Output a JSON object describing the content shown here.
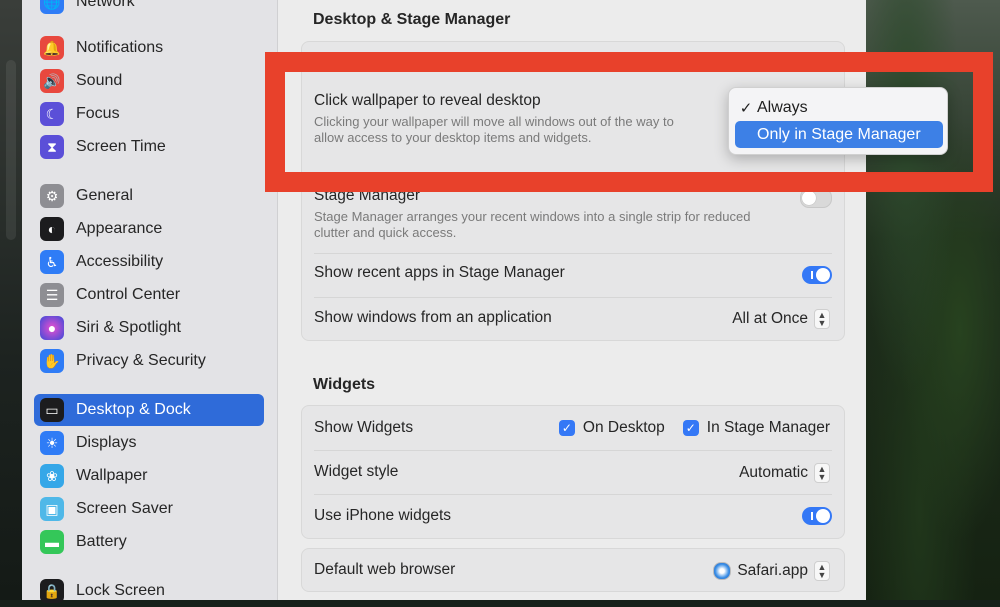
{
  "sidebar": {
    "items": [
      {
        "label": "Network",
        "icon": "globe-icon",
        "color": "#2f7cf6"
      },
      {
        "label": "Notifications",
        "icon": "bell-icon",
        "color": "#e8483e"
      },
      {
        "label": "Sound",
        "icon": "speaker-icon",
        "color": "#e8483e"
      },
      {
        "label": "Focus",
        "icon": "moon-icon",
        "color": "#5b4fd8"
      },
      {
        "label": "Screen Time",
        "icon": "hourglass-icon",
        "color": "#5b4fd8"
      },
      {
        "label": "General",
        "icon": "gear-icon",
        "color": "#8e8e93"
      },
      {
        "label": "Appearance",
        "icon": "appearance-icon",
        "color": "#1c1c1e"
      },
      {
        "label": "Accessibility",
        "icon": "accessibility-icon",
        "color": "#2f7cf6"
      },
      {
        "label": "Control Center",
        "icon": "switches-icon",
        "color": "#8e8e93"
      },
      {
        "label": "Siri & Spotlight",
        "icon": "siri-icon",
        "color": "#7b4fc9"
      },
      {
        "label": "Privacy & Security",
        "icon": "hand-icon",
        "color": "#2f7cf6"
      },
      {
        "label": "Desktop & Dock",
        "icon": "dock-icon",
        "color": "#1c1c1e"
      },
      {
        "label": "Displays",
        "icon": "sun-icon",
        "color": "#2f7cf6"
      },
      {
        "label": "Wallpaper",
        "icon": "flower-icon",
        "color": "#35a7e8"
      },
      {
        "label": "Screen Saver",
        "icon": "screen-saver-icon",
        "color": "#4fb8e8"
      },
      {
        "label": "Battery",
        "icon": "battery-icon",
        "color": "#34c759"
      },
      {
        "label": "Lock Screen",
        "icon": "lock-icon",
        "color": "#1c1c1e"
      }
    ]
  },
  "stage_section": {
    "title": "Desktop & Stage Manager",
    "wallpaper": {
      "label": "Click wallpaper to reveal desktop",
      "description_1": "Clicking your wallpaper will move all windows out of the way to",
      "description_2": "allow access to your desktop items and widgets."
    },
    "popup": {
      "options": [
        "Always",
        "Only in Stage Manager"
      ],
      "checked": "Always",
      "highlighted": "Only in Stage Manager",
      "check_mark": "✓"
    },
    "stage_manager": {
      "label": "Stage Manager",
      "description_1": "Stage Manager arranges your recent windows into a single strip for reduced",
      "description_2": "clutter and quick access.",
      "enabled": false
    },
    "recent_apps": {
      "label": "Show recent apps in Stage Manager",
      "enabled": true
    },
    "windows_from_app": {
      "label": "Show windows from an application",
      "value": "All at Once"
    }
  },
  "widgets_section": {
    "title": "Widgets",
    "show_widgets": {
      "label": "Show Widgets",
      "on_desktop": "On Desktop",
      "in_stage_manager": "In Stage Manager"
    },
    "widget_style": {
      "label": "Widget style",
      "value": "Automatic"
    },
    "iphone_widgets": {
      "label": "Use iPhone widgets",
      "enabled": true
    }
  },
  "browser": {
    "label": "Default web browser",
    "value": "Safari.app"
  },
  "colors": {
    "accent": "#3478f6",
    "highlight_frame": "#e8412b",
    "selected": "#2f6bd9"
  }
}
